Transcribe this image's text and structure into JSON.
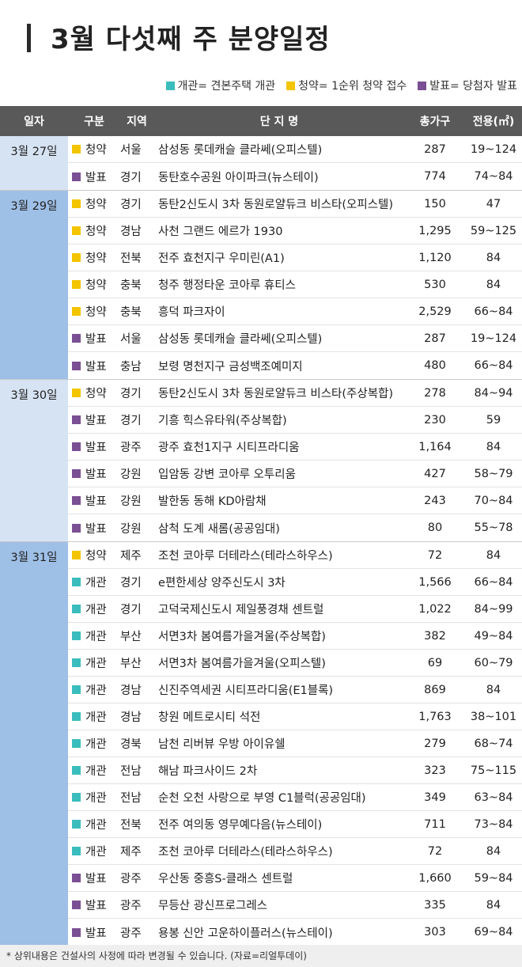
{
  "title": "3월 다섯째 주 분양일정",
  "legend": [
    {
      "label": "개관= 견본주택 개관",
      "color": "#3bbdbd"
    },
    {
      "label": "청약= 1순위 청약 접수",
      "color": "#f2c500"
    },
    {
      "label": "발표= 당첨자 발표",
      "color": "#7a4f93"
    }
  ],
  "header": {
    "date": "일자",
    "category": "구분",
    "region": "지역",
    "name": "단 지 명",
    "households": "총가구",
    "area": "전용(㎡)"
  },
  "colors": {
    "개관": "#3bbdbd",
    "청약": "#f2c500",
    "발표": "#7a4f93"
  },
  "groups": [
    {
      "date": "3월 27일",
      "rows": [
        {
          "category": "청약",
          "region": "서울",
          "name": "삼성동 롯데캐슬 클라쎄(오피스텔)",
          "households": "287",
          "area": "19~124"
        },
        {
          "category": "발표",
          "region": "경기",
          "name": "동탄호수공원 아이파크(뉴스테이)",
          "households": "774",
          "area": "74~84"
        }
      ]
    },
    {
      "date": "3월 29일",
      "rows": [
        {
          "category": "청약",
          "region": "경기",
          "name": "동탄2신도시 3차 동원로얄듀크 비스타(오피스텔)",
          "households": "150",
          "area": "47"
        },
        {
          "category": "청약",
          "region": "경남",
          "name": "사천 그랜드 에르가 1930",
          "households": "1,295",
          "area": "59~125"
        },
        {
          "category": "청약",
          "region": "전북",
          "name": "전주 효천지구 우미린(A1)",
          "households": "1,120",
          "area": "84"
        },
        {
          "category": "청약",
          "region": "충북",
          "name": "청주 행정타운 코아루 휴티스",
          "households": "530",
          "area": "84"
        },
        {
          "category": "청약",
          "region": "충북",
          "name": "흥덕 파크자이",
          "households": "2,529",
          "area": "66~84"
        },
        {
          "category": "발표",
          "region": "서울",
          "name": "삼성동 롯데캐슬 클라쎄(오피스텔)",
          "households": "287",
          "area": "19~124"
        },
        {
          "category": "발표",
          "region": "충남",
          "name": "보령 명천지구 금성백조예미지",
          "households": "480",
          "area": "66~84"
        }
      ]
    },
    {
      "date": "3월 30일",
      "rows": [
        {
          "category": "청약",
          "region": "경기",
          "name": "동탄2신도시 3차 동원로얄듀크 비스타(주상복합)",
          "households": "278",
          "area": "84~94"
        },
        {
          "category": "발표",
          "region": "경기",
          "name": "기흥 힉스유타워(주상복합)",
          "households": "230",
          "area": "59"
        },
        {
          "category": "발표",
          "region": "광주",
          "name": "광주 효천1지구 시티프라디움",
          "households": "1,164",
          "area": "84"
        },
        {
          "category": "발표",
          "region": "강원",
          "name": "입암동 강변 코아루 오투리움",
          "households": "427",
          "area": "58~79"
        },
        {
          "category": "발표",
          "region": "강원",
          "name": "발한동 동해 KD아람채",
          "households": "243",
          "area": "70~84"
        },
        {
          "category": "발표",
          "region": "강원",
          "name": "삼척 도계 새롬(공공임대)",
          "households": "80",
          "area": "55~78"
        }
      ]
    },
    {
      "date": "3월 31일",
      "rows": [
        {
          "category": "청약",
          "region": "제주",
          "name": "조천 코아루 더테라스(테라스하우스)",
          "households": "72",
          "area": "84"
        },
        {
          "category": "개관",
          "region": "경기",
          "name": "e편한세상 양주신도시 3차",
          "households": "1,566",
          "area": "66~84"
        },
        {
          "category": "개관",
          "region": "경기",
          "name": "고덕국제신도시 제일풍경채 센트럴",
          "households": "1,022",
          "area": "84~99"
        },
        {
          "category": "개관",
          "region": "부산",
          "name": "서면3차 봄여름가을겨울(주상복합)",
          "households": "382",
          "area": "49~84"
        },
        {
          "category": "개관",
          "region": "부산",
          "name": "서면3차 봄여름가을겨울(오피스텔)",
          "households": "69",
          "area": "60~79"
        },
        {
          "category": "개관",
          "region": "경남",
          "name": "신진주역세권 시티프라디움(E1블록)",
          "households": "869",
          "area": "84"
        },
        {
          "category": "개관",
          "region": "경남",
          "name": "창원 메트로시티 석전",
          "households": "1,763",
          "area": "38~101"
        },
        {
          "category": "개관",
          "region": "경북",
          "name": "남천 리버뷰 우방 아이유쉘",
          "households": "279",
          "area": "68~74"
        },
        {
          "category": "개관",
          "region": "전남",
          "name": "해남 파크사이드 2차",
          "households": "323",
          "area": "75~115"
        },
        {
          "category": "개관",
          "region": "전남",
          "name": "순천 오천 사랑으로 부영 C1블럭(공공임대)",
          "households": "349",
          "area": "63~84"
        },
        {
          "category": "개관",
          "region": "전북",
          "name": "전주 여의동 영무예다음(뉴스테이)",
          "households": "711",
          "area": "73~84"
        },
        {
          "category": "개관",
          "region": "제주",
          "name": "조천 코아루 더테라스(테라스하우스)",
          "households": "72",
          "area": "84"
        },
        {
          "category": "발표",
          "region": "광주",
          "name": "우산동 중흥S-클래스 센트럴",
          "households": "1,660",
          "area": "59~84"
        },
        {
          "category": "발표",
          "region": "광주",
          "name": "무등산 광신프로그레스",
          "households": "335",
          "area": "84"
        },
        {
          "category": "발표",
          "region": "광주",
          "name": "용봉 신안 고운하이플러스(뉴스테이)",
          "households": "303",
          "area": "69~84"
        }
      ]
    }
  ],
  "footnote": "* 상위내용은 건설사의 사정에 따라 변경될 수 있습니다. (자료=리얼투데이)"
}
